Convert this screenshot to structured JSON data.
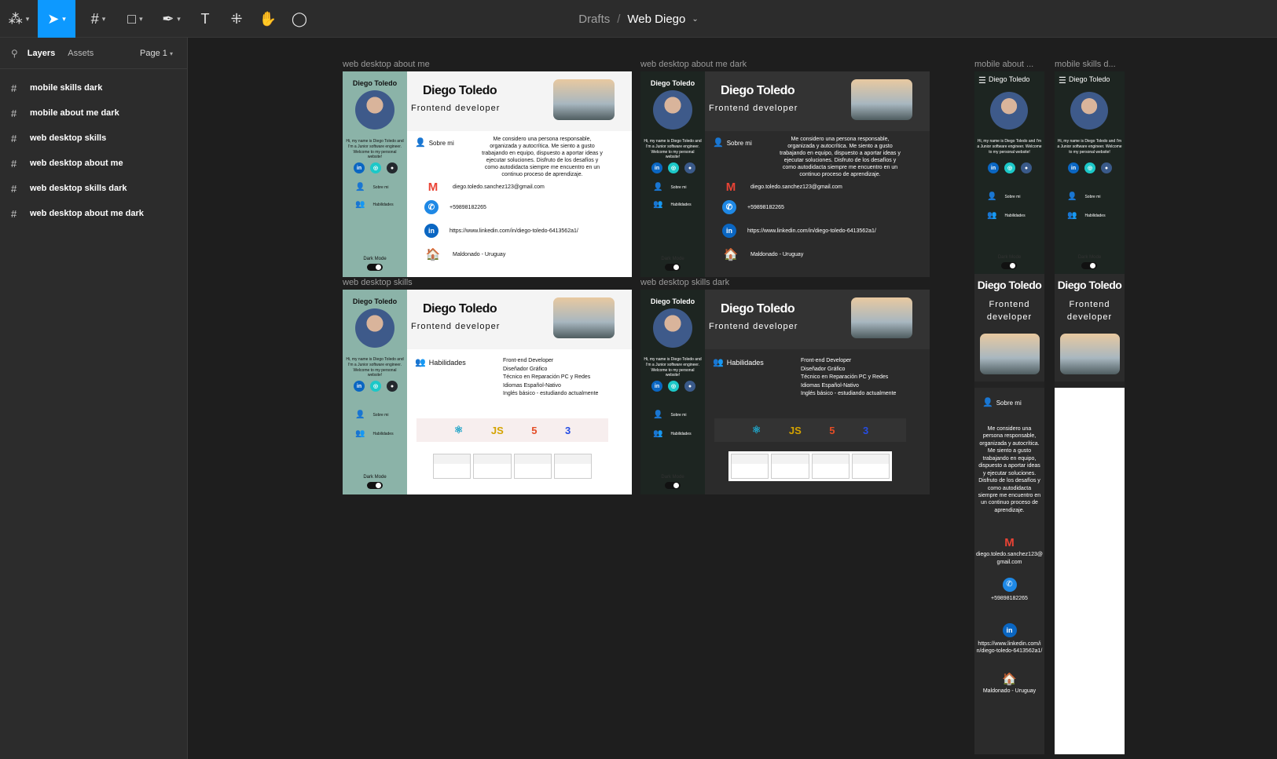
{
  "toolbar": {
    "title": "Drafts",
    "separator": "/",
    "file": "Web Diego"
  },
  "sidebar": {
    "tab_layers": "Layers",
    "tab_assets": "Assets",
    "page": "Page 1",
    "layers": [
      {
        "label": "mobile skills dark"
      },
      {
        "label": "mobile about me dark"
      },
      {
        "label": "web desktop skills"
      },
      {
        "label": "web desktop about me"
      },
      {
        "label": "web desktop skills dark"
      },
      {
        "label": "web desktop about me dark"
      }
    ]
  },
  "frames": {
    "about": "web desktop about me",
    "about_dark": "web desktop about me dark",
    "skills": "web desktop skills",
    "skills_dark": "web desktop skills dark",
    "mobile_about": "mobile about ...",
    "mobile_skills": "mobile skills d..."
  },
  "profile": {
    "name": "Diego Toledo",
    "role": "Frontend developer",
    "role_l1": "Frontend",
    "role_l2": "developer",
    "intro": "Hi, my name is Diego Toledo and I'm a Junior software engineer. Welcome to my personal website!",
    "nav_about": "Sobre mi",
    "nav_skills": "Habilidades",
    "dark_mode": "Dark Mode",
    "about_title": "Sobre mi",
    "about_text": "Me considero una persona responsable, organizada y autocrítica. Me siento a gusto trabajando en equipo, dispuesto a aportar ideas y ejecutar soluciones. Disfruto de los desafíos y como autodidacta siempre me encuentro en un continuo proceso de aprendizaje.",
    "email": "diego.toledo.sanchez123@gmail.com",
    "email_mobile": "diego.toledo.sanchez123@gmail.com",
    "phone": "+59898182265",
    "linkedin": "https://www.linkedin.com/in/diego-toledo-6413562a1/",
    "location": "Maldonado - Uruguay",
    "skills_title": "Habilidades",
    "skills": [
      "Front-end Developer",
      "Diseñador Gráfico",
      "Técnico en Reparación PC y Redes",
      "Idiomas Español-Nativo",
      "Inglés básico - estudiando actualmente"
    ]
  },
  "colors": {
    "canvas": "#1e1e1e",
    "panel": "#2c2c2c",
    "accent": "#0d99ff",
    "sidebar_light": "#8bb3a8",
    "sidebar_dark": "#1d2521",
    "dark_bg": "#2b2b2b",
    "dark_header": "#333333"
  },
  "icons": {
    "mail": "gmail-icon",
    "phone": "phone-icon",
    "linkedin": "linkedin-icon",
    "home": "home-icon",
    "react": "react-icon",
    "js": "js-icon",
    "html": "html5-icon",
    "css": "css3-icon"
  }
}
